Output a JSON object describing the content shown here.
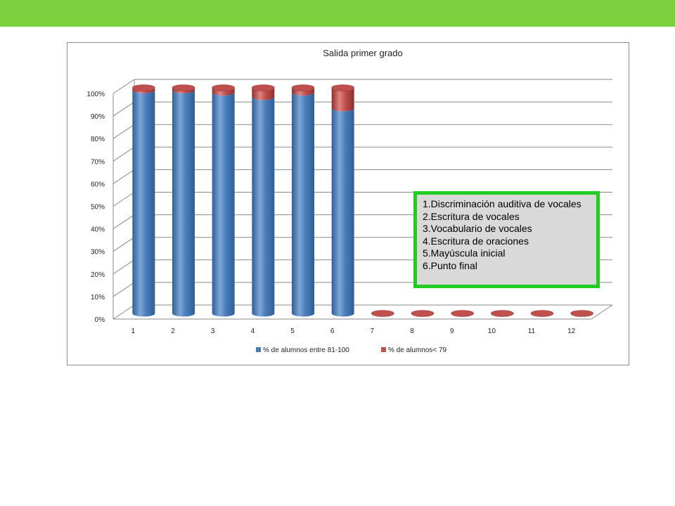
{
  "colors": {
    "top_bar": "#7ccf3d",
    "series1": "#4a7ebb",
    "series2": "#c0504d",
    "note_border": "#22cc22",
    "note_bg": "#d9d9d9"
  },
  "chart_data": {
    "type": "bar",
    "style": "3d-cylinder-stacked",
    "title": "Salida primer grado",
    "categories": [
      "1",
      "2",
      "3",
      "4",
      "5",
      "6",
      "7",
      "8",
      "9",
      "10",
      "11",
      "12"
    ],
    "series": [
      {
        "name": "% de alumnos entre 81-100",
        "color": "#4a7ebb",
        "values": [
          99,
          99,
          98,
          96,
          98,
          91,
          0,
          0,
          0,
          0,
          0,
          0
        ]
      },
      {
        "name": "% de alumnos< 79",
        "color": "#c0504d",
        "values": [
          1,
          1,
          2,
          4,
          2,
          9,
          0,
          0,
          0,
          0,
          0,
          0
        ]
      }
    ],
    "yticks": [
      "0%",
      "10%",
      "20%",
      "30%",
      "40%",
      "50%",
      "60%",
      "70%",
      "80%",
      "90%",
      "100%"
    ],
    "ylim": [
      0,
      100
    ],
    "grid": true,
    "legend_position": "bottom"
  },
  "note": {
    "lines": [
      "1.Discriminación auditiva de vocales",
      "2.Escritura de vocales",
      "3.Vocabulario de vocales",
      "4.Escritura de oraciones",
      "5.Mayúscula inicial",
      "6.Punto final"
    ]
  }
}
